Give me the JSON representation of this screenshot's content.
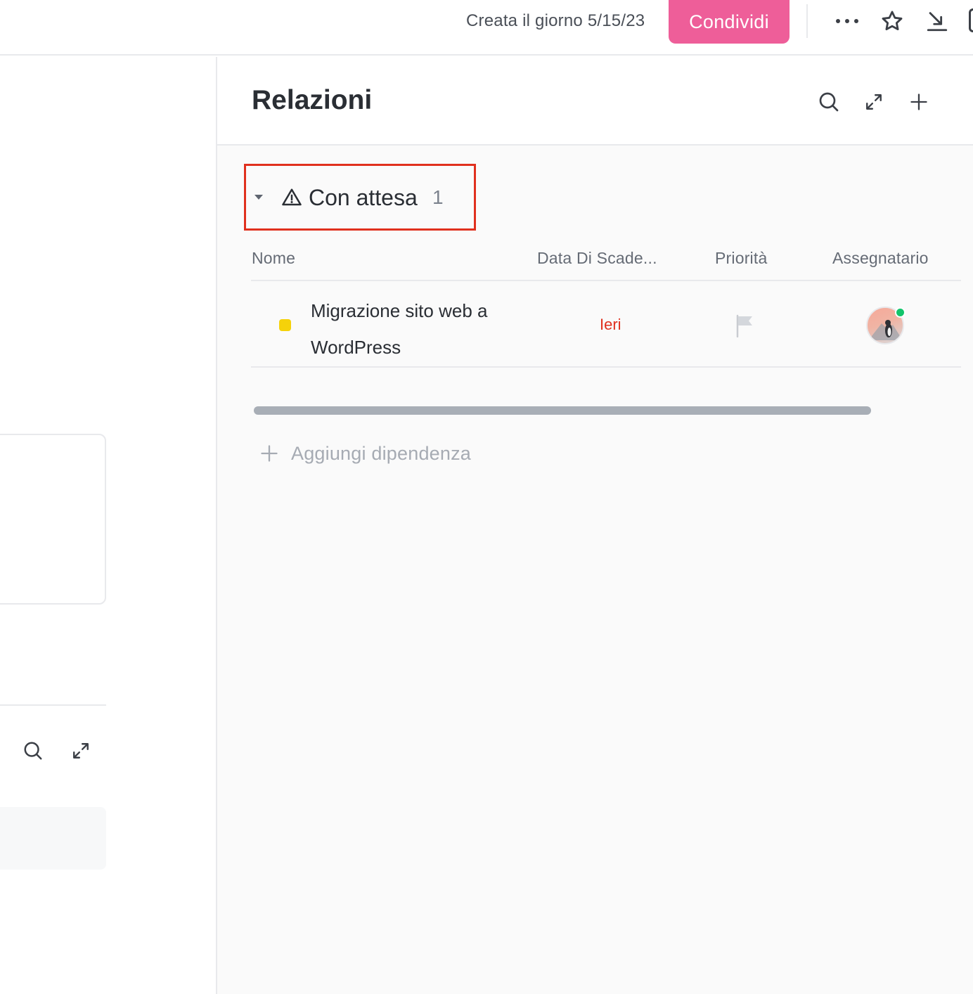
{
  "topbar": {
    "created_text": "Creata il giorno 5/15/23",
    "share_label": "Condividi",
    "icons": [
      "more-icon",
      "star-icon",
      "download-icon"
    ]
  },
  "relations": {
    "title": "Relazioni",
    "header_icons": [
      "search-icon",
      "expand-icon",
      "plus-icon"
    ],
    "group": {
      "label": "Con attesa",
      "count": "1",
      "icon": "warning-icon"
    },
    "columns": {
      "name": "Nome",
      "due_date": "Data Di Scade...",
      "priority": "Priorità",
      "assignee": "Assegnatario"
    },
    "tasks": [
      {
        "name": "Migrazione sito web a WordPress",
        "status_color": "#f5d20a",
        "due": "Ieri",
        "due_color": "#e0301e",
        "priority_icon": "flag-icon"
      }
    ],
    "add_dependency": "Aggiungi dipendenza"
  },
  "colors": {
    "accent": "#ee5e99",
    "highlight_border": "#e0301e",
    "online": "#12c46b"
  }
}
